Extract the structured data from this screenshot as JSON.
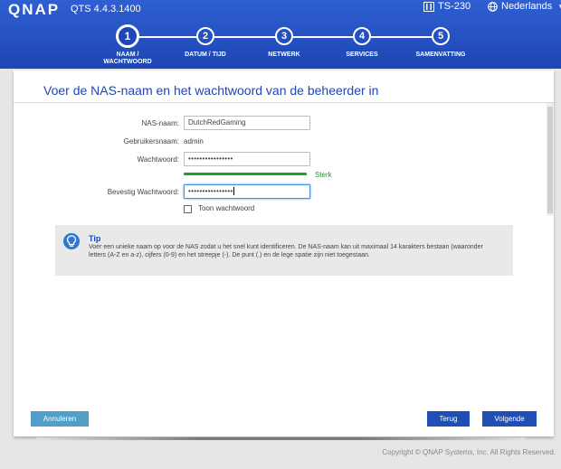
{
  "header": {
    "brand": "QNAP",
    "version": "QTS 4.4.3.1400",
    "device": "TS-230",
    "language": "Nederlands"
  },
  "steps": [
    {
      "number": "1",
      "label_line1": "NAAM /",
      "label_line2": "WACHTWOORD",
      "active": true
    },
    {
      "number": "2",
      "label_line1": "DATUM / TIJD",
      "label_line2": ""
    },
    {
      "number": "3",
      "label_line1": "NETWERK",
      "label_line2": ""
    },
    {
      "number": "4",
      "label_line1": "SERVICES",
      "label_line2": ""
    },
    {
      "number": "5",
      "label_line1": "SAMENVATTING",
      "label_line2": ""
    }
  ],
  "card": {
    "title": "Voer de NAS-naam en het wachtwoord van de beheerder in"
  },
  "form": {
    "nas_name_label": "NAS-naam:",
    "nas_name_value": "DutchRedGaming",
    "username_label": "Gebruikersnaam:",
    "username_value": "admin",
    "password_label": "Wachtwoord:",
    "password_value": "••••••••••••••••",
    "strength_text": "Sterk",
    "confirm_label": "Bevestig Wachtwoord:",
    "confirm_value": "••••••••••••••••",
    "show_password_label": "Toon wachtwoord"
  },
  "tip": {
    "title": "Tip",
    "text": "Voer een unieke naam op voor de NAS zodat u het snel kunt identificeren. De NAS-naam kan uit maximaal 14 karakters bestaan (waaronder letters (A-Z en a-z), cijfers (0-9) en het streepje (-). De punt (.) en de lege spatie zijn niet toegestaan."
  },
  "buttons": {
    "cancel": "Annuleren",
    "back": "Terug",
    "next": "Volgende"
  },
  "footer": {
    "copyright": "Copyright © QNAP Systems, Inc. All Rights Reserved."
  },
  "colors": {
    "header_blue": "#1e46b4",
    "accent_blue": "#1f4fb5",
    "cancel_blue": "#4f9fc9",
    "strength_green": "#1fa12f"
  }
}
